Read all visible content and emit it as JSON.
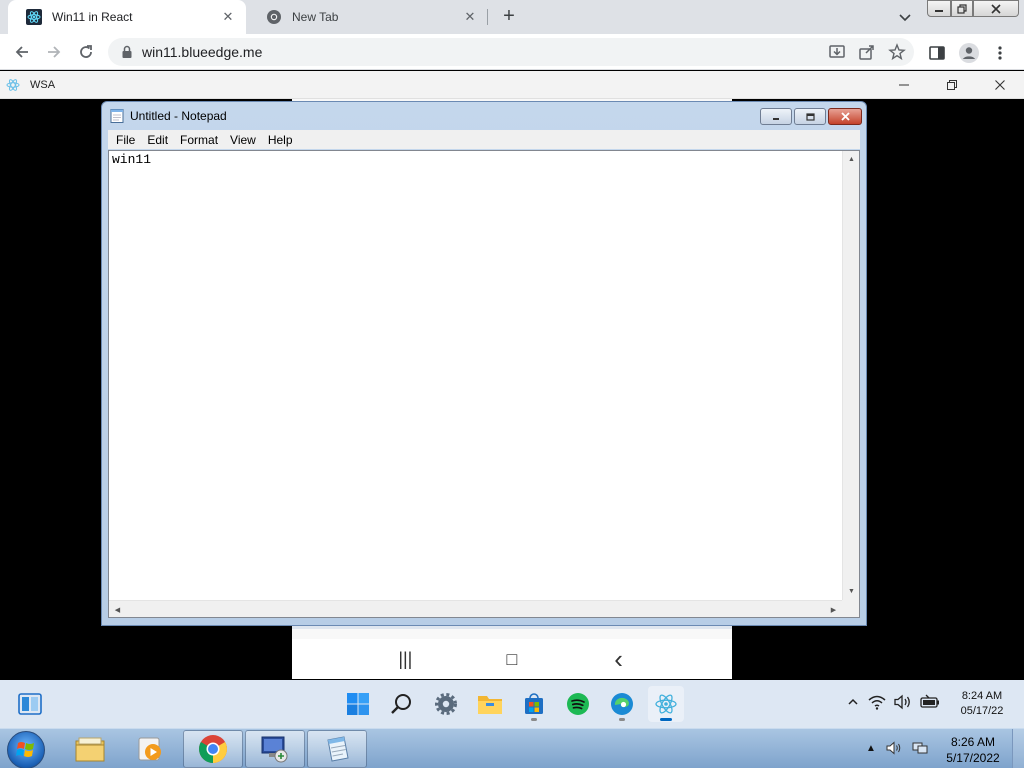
{
  "browser": {
    "tabs": [
      {
        "title": "Win11 in React",
        "active": true
      },
      {
        "title": "New Tab",
        "active": false
      }
    ],
    "address": "win11.blueedge.me",
    "close_glyph": "✕",
    "new_tab_glyph": "+"
  },
  "wsa": {
    "title": "WSA"
  },
  "notepad": {
    "title": "Untitled - Notepad",
    "menu": [
      "File",
      "Edit",
      "Format",
      "View",
      "Help"
    ],
    "content": "win11"
  },
  "android_nav": {
    "recents": "|||",
    "home": "□",
    "back": "‹"
  },
  "win11_taskbar": {
    "time": "8:24 AM",
    "date": "05/17/22"
  },
  "win7_taskbar": {
    "time": "8:26 AM",
    "date": "5/17/2022"
  },
  "colors": {
    "accent": "#0067c0",
    "chrome_tabstrip": "#dee1e6",
    "win11_taskbar": "#dde7f3",
    "notepad_frame": "#b7cde6"
  }
}
